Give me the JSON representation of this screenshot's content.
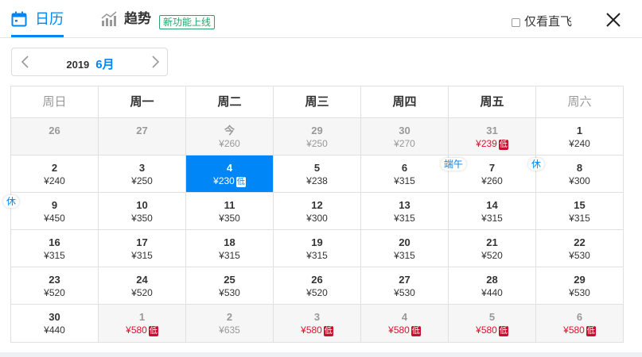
{
  "tabs": {
    "calendar_label": "日历",
    "trend_label": "趋势",
    "new_badge": "新功能上线"
  },
  "filters": {
    "direct_only_label": "仅看直飞",
    "direct_only_checked": false
  },
  "month_nav": {
    "year": "2019",
    "month": "6月"
  },
  "weekdays": [
    "周日",
    "周一",
    "周二",
    "周三",
    "周四",
    "周五",
    "周六"
  ],
  "low_label": "低",
  "colors": {
    "accent": "#0086f6",
    "price_red": "#e0112d",
    "low_badge": "#c8102e",
    "new_badge": "#29a36a"
  },
  "weeks": [
    [
      {
        "day": "26",
        "price": "",
        "past": true
      },
      {
        "day": "27",
        "price": "",
        "past": true
      },
      {
        "day": "今",
        "price": "¥260",
        "past": true
      },
      {
        "day": "29",
        "price": "¥250",
        "past": true
      },
      {
        "day": "30",
        "price": "¥270",
        "past": true
      },
      {
        "day": "31",
        "price": "¥239",
        "past": true,
        "red": true,
        "low": true
      },
      {
        "day": "1",
        "price": "¥240"
      }
    ],
    [
      {
        "day": "2",
        "price": "¥240"
      },
      {
        "day": "3",
        "price": "¥250"
      },
      {
        "day": "4",
        "price": "¥230",
        "low": true,
        "selected": true
      },
      {
        "day": "5",
        "price": "¥238"
      },
      {
        "day": "6",
        "price": "¥315"
      },
      {
        "day": "7",
        "price": "¥260",
        "tag": "端午"
      },
      {
        "day": "8",
        "price": "¥300",
        "tag": "休"
      }
    ],
    [
      {
        "day": "9",
        "price": "¥450",
        "tag": "休"
      },
      {
        "day": "10",
        "price": "¥350"
      },
      {
        "day": "11",
        "price": "¥350"
      },
      {
        "day": "12",
        "price": "¥300"
      },
      {
        "day": "13",
        "price": "¥315"
      },
      {
        "day": "14",
        "price": "¥315"
      },
      {
        "day": "15",
        "price": "¥315"
      }
    ],
    [
      {
        "day": "16",
        "price": "¥315"
      },
      {
        "day": "17",
        "price": "¥315"
      },
      {
        "day": "18",
        "price": "¥315"
      },
      {
        "day": "19",
        "price": "¥315"
      },
      {
        "day": "20",
        "price": "¥315"
      },
      {
        "day": "21",
        "price": "¥520"
      },
      {
        "day": "22",
        "price": "¥530"
      }
    ],
    [
      {
        "day": "23",
        "price": "¥520"
      },
      {
        "day": "24",
        "price": "¥520"
      },
      {
        "day": "25",
        "price": "¥530"
      },
      {
        "day": "26",
        "price": "¥520"
      },
      {
        "day": "27",
        "price": "¥530"
      },
      {
        "day": "28",
        "price": "¥440"
      },
      {
        "day": "29",
        "price": "¥530"
      }
    ],
    [
      {
        "day": "30",
        "price": "¥440"
      },
      {
        "day": "1",
        "price": "¥580",
        "past": true,
        "red": true,
        "low": true
      },
      {
        "day": "2",
        "price": "¥635",
        "past": true
      },
      {
        "day": "3",
        "price": "¥580",
        "past": true,
        "red": true,
        "low": true
      },
      {
        "day": "4",
        "price": "¥580",
        "past": true,
        "red": true,
        "low": true
      },
      {
        "day": "5",
        "price": "¥580",
        "past": true,
        "red": true,
        "low": true
      },
      {
        "day": "6",
        "price": "¥580",
        "past": true,
        "red": true,
        "low": true
      }
    ]
  ]
}
